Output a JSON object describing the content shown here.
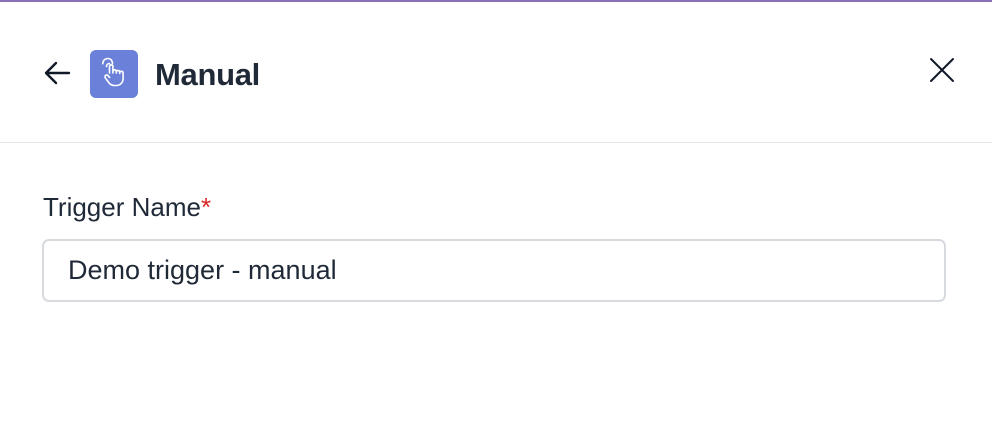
{
  "header": {
    "title": "Manual",
    "back_icon": "arrow-left-icon",
    "app_icon": "hand-pointer-icon",
    "close_icon": "close-icon"
  },
  "form": {
    "trigger_name_label": "Trigger Name",
    "required_mark": "*",
    "trigger_name_value": "Demo trigger - manual"
  },
  "colors": {
    "accent": "#8b6fb8",
    "app_icon_bg": "#6b80d8",
    "required": "#dc2626",
    "text": "#1f2937",
    "border": "#d7dbe0"
  }
}
